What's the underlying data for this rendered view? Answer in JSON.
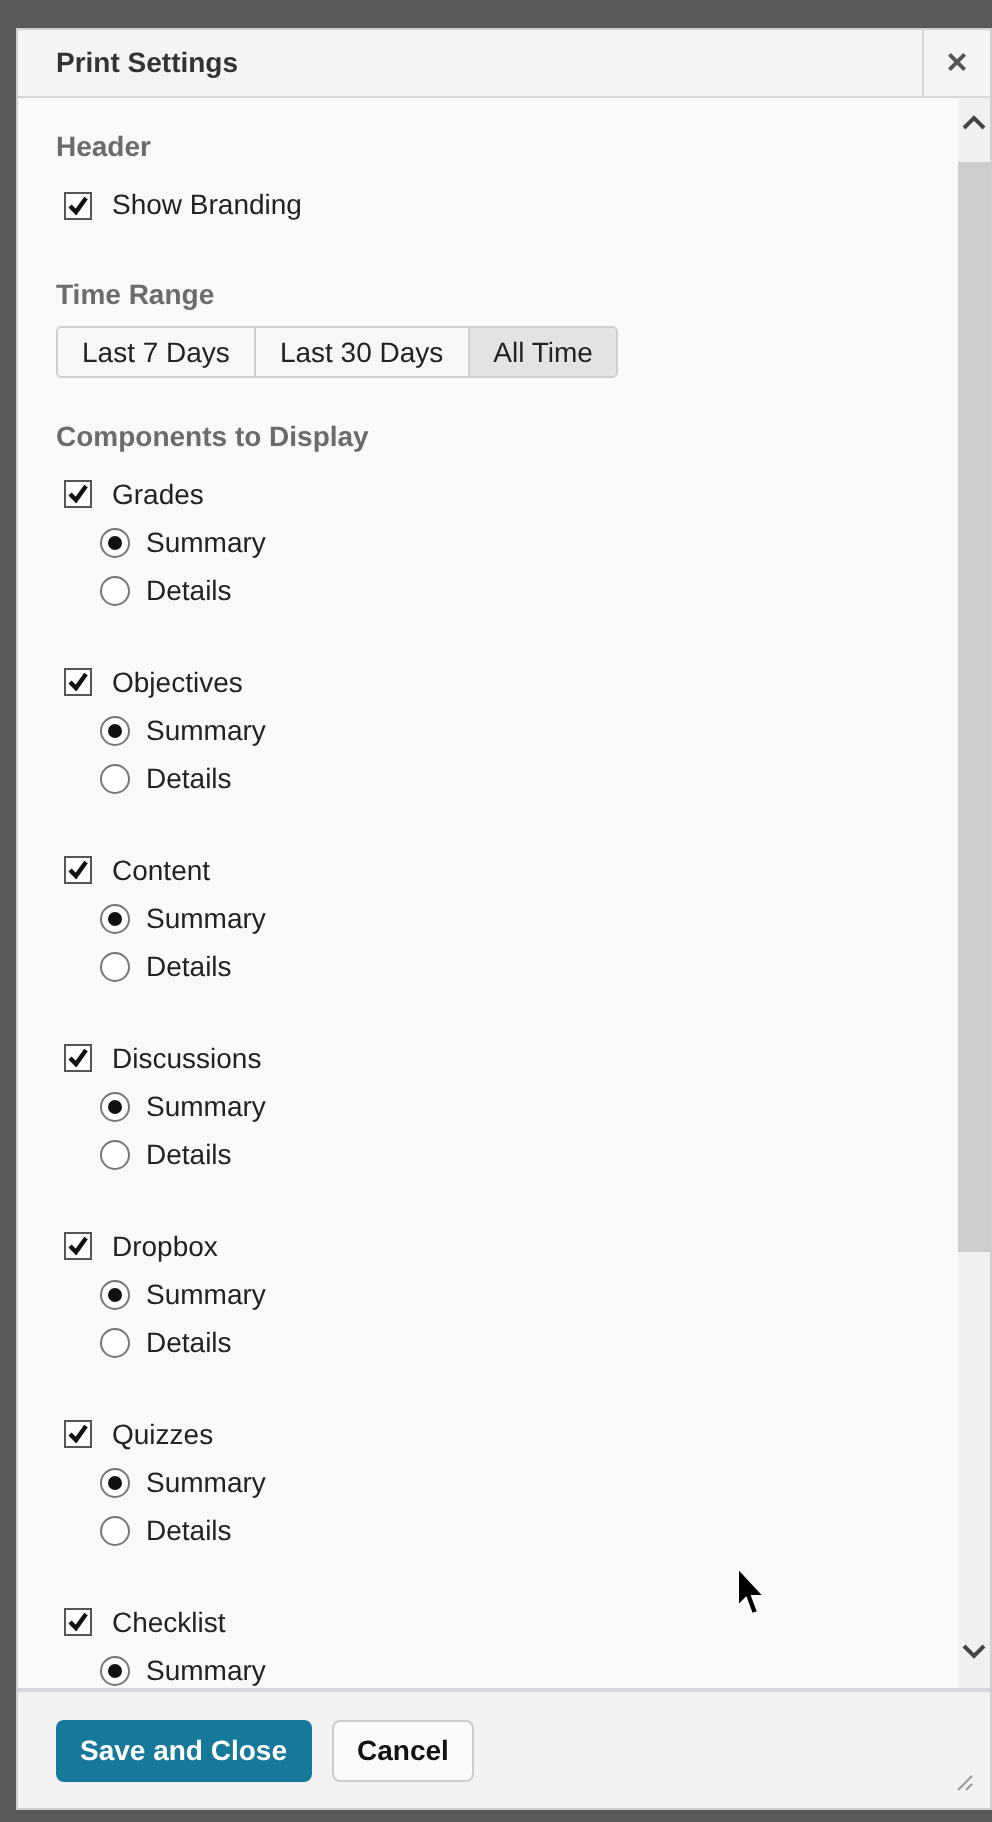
{
  "dialog": {
    "title": "Print Settings",
    "close": "×"
  },
  "header_section": {
    "heading": "Header",
    "options": [
      {
        "label": "Show Branding",
        "checked": true
      }
    ]
  },
  "time_range": {
    "heading": "Time Range",
    "options": [
      {
        "label": "Last 7 Days",
        "selected": false
      },
      {
        "label": "Last 30 Days",
        "selected": false
      },
      {
        "label": "All Time",
        "selected": true
      }
    ]
  },
  "components": {
    "heading": "Components to Display",
    "items": [
      {
        "label": "Grades",
        "checked": true,
        "modes": [
          {
            "label": "Summary",
            "selected": true
          },
          {
            "label": "Details",
            "selected": false
          }
        ]
      },
      {
        "label": "Objectives",
        "checked": true,
        "modes": [
          {
            "label": "Summary",
            "selected": true
          },
          {
            "label": "Details",
            "selected": false
          }
        ]
      },
      {
        "label": "Content",
        "checked": true,
        "modes": [
          {
            "label": "Summary",
            "selected": true
          },
          {
            "label": "Details",
            "selected": false
          }
        ]
      },
      {
        "label": "Discussions",
        "checked": true,
        "modes": [
          {
            "label": "Summary",
            "selected": true
          },
          {
            "label": "Details",
            "selected": false
          }
        ]
      },
      {
        "label": "Dropbox",
        "checked": true,
        "modes": [
          {
            "label": "Summary",
            "selected": true
          },
          {
            "label": "Details",
            "selected": false
          }
        ]
      },
      {
        "label": "Quizzes",
        "checked": true,
        "modes": [
          {
            "label": "Summary",
            "selected": true
          },
          {
            "label": "Details",
            "selected": false
          }
        ]
      },
      {
        "label": "Checklist",
        "checked": true,
        "modes": [
          {
            "label": "Summary",
            "selected": true
          }
        ]
      }
    ]
  },
  "footer": {
    "buttons": [
      {
        "label": "Save and Close",
        "kind": "primary"
      },
      {
        "label": "Cancel",
        "kind": "secondary"
      }
    ]
  }
}
